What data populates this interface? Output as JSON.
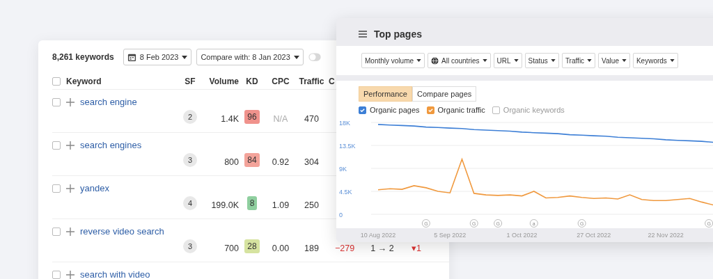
{
  "keywords_panel": {
    "count": "8,261 keywords",
    "select_all_checked": false,
    "toggle_on": false,
    "date_button": "8 Feb 2023",
    "compare_button": "Compare with: 8 Jan 2023",
    "table": {
      "columns": [
        "Keyword",
        "SF",
        "Volume",
        "KD",
        "CPC",
        "Traffic",
        "C"
      ],
      "rows": [
        {
          "checked": false,
          "keyword": "search engine",
          "sf": "2",
          "volume": "1.4K",
          "kd": {
            "value": "96",
            "color": "#f0928c"
          },
          "cpc": "N/A",
          "cpc_dimmed": true,
          "traffic": "470"
        },
        {
          "checked": false,
          "keyword": "search engines",
          "sf": "3",
          "volume": "800",
          "kd": {
            "value": "84",
            "color": "#f3a39a"
          },
          "cpc": "0.92",
          "cpc_dimmed": false,
          "traffic": "304"
        },
        {
          "checked": false,
          "keyword": "yandex",
          "sf": "4",
          "volume": "199.0K",
          "kd": {
            "value": "8",
            "color": "#8fcf9f"
          },
          "cpc": "1.09",
          "cpc_dimmed": false,
          "traffic": "250"
        },
        {
          "checked": false,
          "keyword": "reverse video search",
          "sf": "3",
          "volume": "700",
          "kd": {
            "value": "28",
            "color": "#d6e3a0"
          },
          "cpc": "0.00",
          "cpc_dimmed": false,
          "traffic": "189",
          "c": "−279",
          "column_8": "1 → 2",
          "column_9": "▾1"
        },
        {
          "checked": false,
          "keyword": "search with video"
        }
      ]
    }
  },
  "top_pages": {
    "title": "Top pages",
    "filters": [
      {
        "label": "Monthly volume",
        "icon": false
      },
      {
        "label": "All countries",
        "icon": true
      },
      {
        "label": "URL",
        "icon": false
      },
      {
        "label": "Status",
        "icon": false
      },
      {
        "label": "Traffic",
        "icon": false
      },
      {
        "label": "Value",
        "icon": false
      },
      {
        "label": "Keywords",
        "icon": false
      }
    ],
    "tabs": [
      {
        "label": "Performance",
        "selected": true
      },
      {
        "label": "Compare pages",
        "selected": false
      }
    ],
    "legend": [
      {
        "label": "Organic pages",
        "checked": true,
        "color": "#3d7fd6"
      },
      {
        "label": "Organic traffic",
        "checked": true,
        "color": "#f0993e"
      },
      {
        "label": "Organic keywords",
        "checked": false,
        "color": "#bbbbbb"
      }
    ],
    "event_markers": [
      {
        "text": "G"
      },
      {
        "text": "G"
      },
      {
        "text": "G"
      },
      {
        "text": "a"
      },
      {
        "text": "G"
      },
      {
        "text": "G"
      }
    ],
    "chart_data": {
      "type": "line",
      "grid": true,
      "categories": [
        "10 Aug 2022",
        null,
        null,
        null,
        null,
        null,
        "5 Sep 2022",
        null,
        null,
        null,
        null,
        null,
        "1 Oct 2022",
        null,
        null,
        null,
        null,
        null,
        "27 Oct 2022",
        null,
        null,
        null,
        null,
        null,
        "22 Nov 2022",
        null,
        null,
        null,
        null
      ],
      "yticks": [
        {
          "value": 0,
          "label": "0"
        },
        {
          "value": 4500,
          "label": "4.5K"
        },
        {
          "value": 9000,
          "label": "9K"
        },
        {
          "value": 13500,
          "label": "13.5K"
        },
        {
          "value": 18000,
          "label": "18K"
        }
      ],
      "ylim": [
        0,
        18000
      ],
      "series": [
        {
          "color": "#3d7fd6",
          "values": [
            17600,
            17500,
            17400,
            17300,
            17100,
            17000,
            16900,
            16800,
            16600,
            16500,
            16400,
            16300,
            16100,
            16000,
            15900,
            15800,
            15600,
            15500,
            15400,
            15300,
            15100,
            15000,
            14900,
            14800,
            14600,
            14500,
            14400,
            14300,
            14100
          ]
        },
        {
          "color": "#f0993e",
          "values": [
            4800,
            5000,
            4900,
            5600,
            5200,
            4500,
            4200,
            10800,
            4100,
            3800,
            3700,
            3800,
            3600,
            4500,
            3200,
            3300,
            3600,
            3300,
            3100,
            3200,
            3000,
            3800,
            2900,
            2700,
            2700,
            2900,
            3100,
            2400,
            1800
          ]
        }
      ]
    }
  }
}
